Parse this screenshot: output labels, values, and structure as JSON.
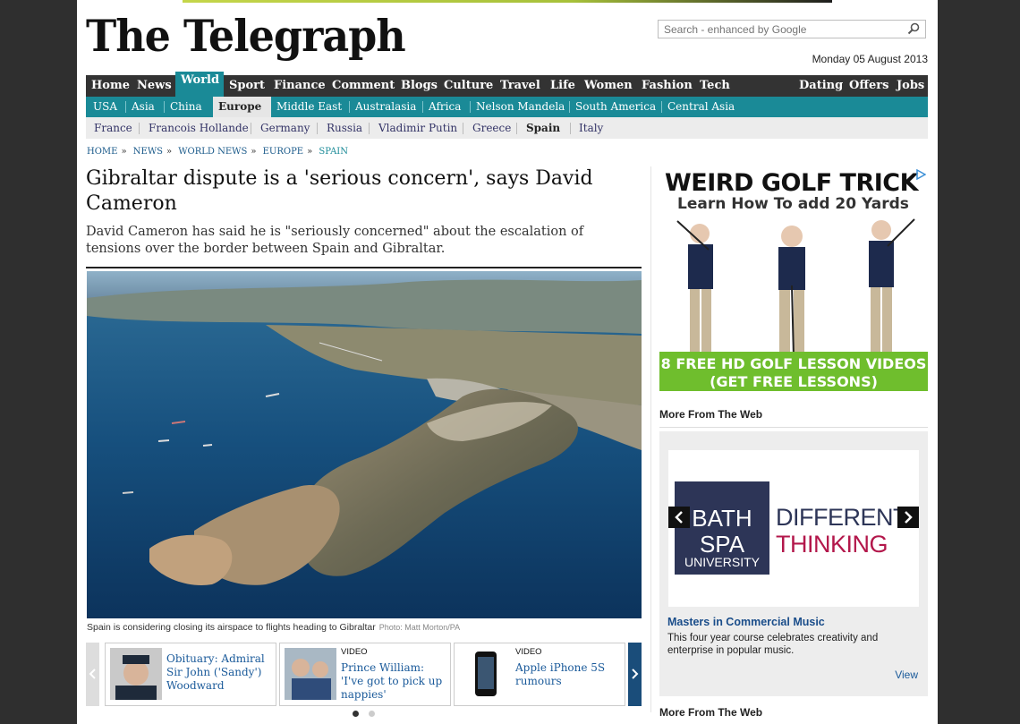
{
  "site": {
    "masthead": "The Telegraph",
    "date": "Monday 05 August 2013"
  },
  "search": {
    "placeholder": "Search - enhanced by Google"
  },
  "nav_primary": {
    "left": [
      "Home",
      "News",
      "World",
      "Sport",
      "Finance",
      "Comment",
      "Blogs",
      "Culture",
      "Travel",
      "Life",
      "Women",
      "Fashion",
      "Tech"
    ],
    "right": [
      "Dating",
      "Offers",
      "Jobs"
    ],
    "active": "World"
  },
  "nav_secondary": {
    "items": [
      "USA",
      "Asia",
      "China",
      "Europe",
      "Middle East",
      "Australasia",
      "Africa",
      "Nelson Mandela",
      "South America",
      "Central Asia"
    ],
    "active": "Europe"
  },
  "nav_tertiary": {
    "items": [
      "France",
      "Francois Hollande",
      "Germany",
      "Russia",
      "Vladimir Putin",
      "Greece",
      "Spain",
      "Italy"
    ],
    "active": "Spain"
  },
  "breadcrumb": [
    "HOME",
    "NEWS",
    "WORLD NEWS",
    "EUROPE",
    "SPAIN"
  ],
  "article": {
    "headline": "Gibraltar dispute is a 'serious concern', says David Cameron",
    "standfirst": "David Cameron has said he is \"seriously concerned\" about the escalation of tensions over the border between Spain and Gibraltar.",
    "caption": "Spain is considering closing its airspace to flights heading to Gibraltar",
    "credit": "Photo: Matt Morton/PA"
  },
  "related": [
    {
      "kicker": "",
      "title": "Obituary: Admiral Sir John ('Sandy') Woodward"
    },
    {
      "kicker": "VIDEO",
      "title": "Prince William: 'I've got to pick up nappies'"
    },
    {
      "kicker": "VIDEO",
      "title": "Apple iPhone 5S rumours"
    }
  ],
  "ad_golf": {
    "headline": "WEIRD GOLF TRICK",
    "subhead": "Learn How To add 20 Yards",
    "cta1": "8 FREE HD GOLF LESSON VIDEOS",
    "cta2": "(GET FREE LESSONS)"
  },
  "more_from_web": {
    "heading": "More From The Web",
    "logo": [
      "BATH",
      "SPA",
      "UNIVERSITY"
    ],
    "tag1": "DIFFERENT",
    "tag2": "THINKING",
    "title": "Masters in Commercial Music",
    "desc": "This four year course celebrates creativity and enterprise in popular music.",
    "view": "View"
  },
  "more_from_web_2": {
    "heading": "More From The Web"
  },
  "colors": {
    "nav_dark": "#333333",
    "nav_teal": "#1a8a97",
    "link_blue": "#1a5a9a"
  }
}
